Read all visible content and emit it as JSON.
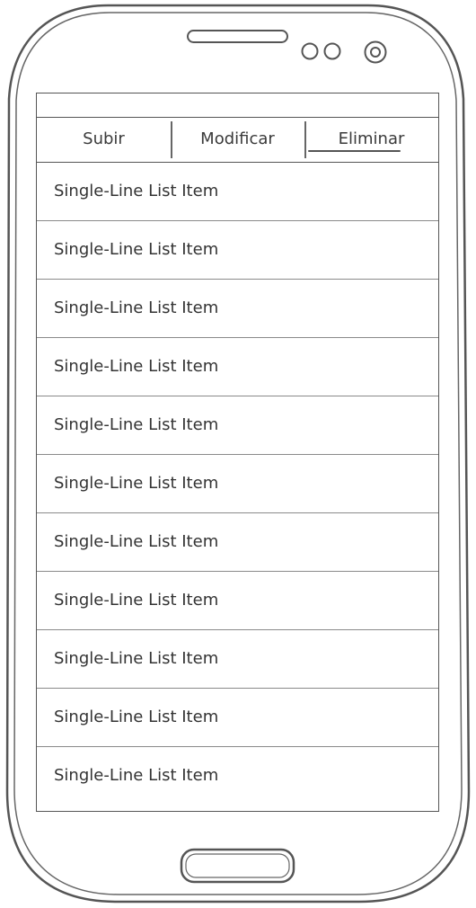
{
  "tabs": [
    {
      "label": "Subir",
      "active": false
    },
    {
      "label": "Modificar",
      "active": false
    },
    {
      "label": "Eliminar",
      "active": true
    }
  ],
  "list": {
    "items": [
      {
        "label": "Single-Line List Item"
      },
      {
        "label": "Single-Line List Item"
      },
      {
        "label": "Single-Line List Item"
      },
      {
        "label": "Single-Line List Item"
      },
      {
        "label": "Single-Line List Item"
      },
      {
        "label": "Single-Line List Item"
      },
      {
        "label": "Single-Line List Item"
      },
      {
        "label": "Single-Line List Item"
      },
      {
        "label": "Single-Line List Item"
      },
      {
        "label": "Single-Line List Item"
      },
      {
        "label": "Single-Line List Item"
      }
    ]
  },
  "colors": {
    "stroke": "#555555",
    "divider": "#8a8a8a",
    "text": "#333333"
  }
}
